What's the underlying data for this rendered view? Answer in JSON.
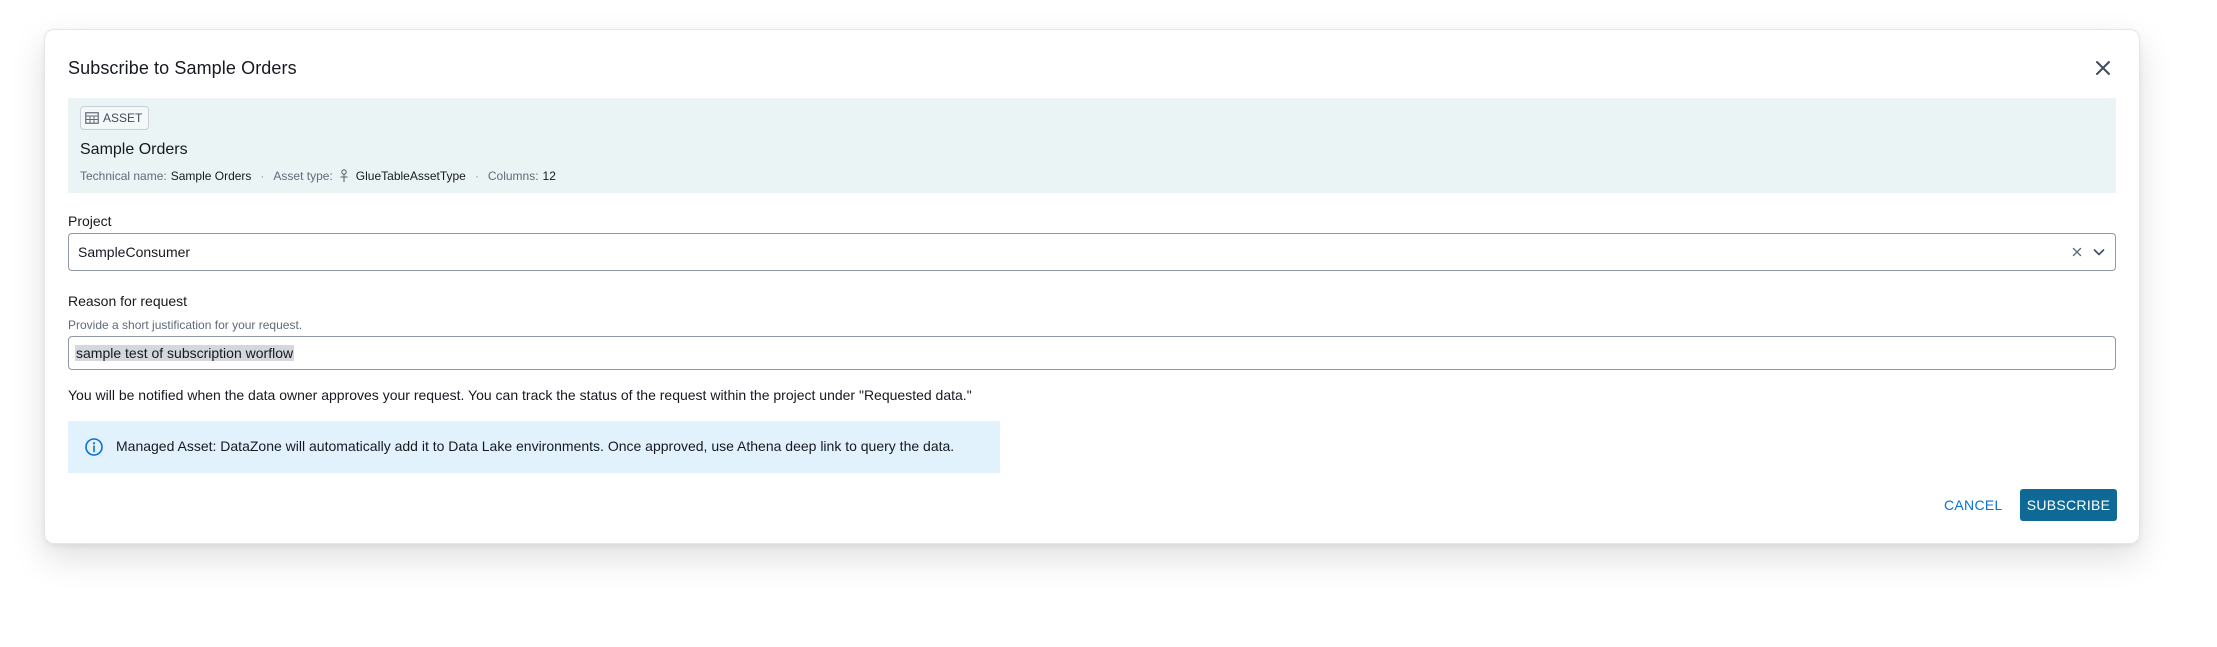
{
  "modal": {
    "title": "Subscribe to Sample Orders"
  },
  "asset": {
    "badge_label": "ASSET",
    "name": "Sample Orders",
    "technical_name_label": "Technical name:",
    "technical_name_value": "Sample Orders",
    "asset_type_label": "Asset type:",
    "asset_type_value": "GlueTableAssetType",
    "columns_label": "Columns:",
    "columns_value": "12",
    "separator": "·"
  },
  "project": {
    "label": "Project",
    "selected_value": "SampleConsumer"
  },
  "reason": {
    "label": "Reason for request",
    "hint": "Provide a short justification for your request.",
    "value": "sample test of subscription worflow"
  },
  "notice_text": "You will be notified when the data owner approves your request. You can track the status of the request within the project under \"Requested data.\"",
  "info": {
    "text": "Managed Asset: DataZone will automatically add it to Data Lake environments. Once approved, use Athena deep link to query the data.",
    "icon": "info-icon"
  },
  "actions": {
    "cancel_label": "CANCEL",
    "subscribe_label": "SUBSCRIBE"
  },
  "colors": {
    "primary": "#0f6996",
    "link": "#0972d3",
    "asset_card_bg": "#ebf4f5",
    "info_bg": "#e2f2fd"
  }
}
